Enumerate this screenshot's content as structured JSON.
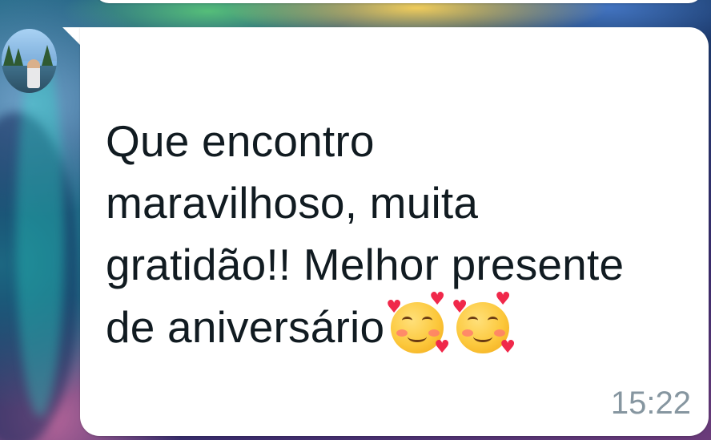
{
  "chat": {
    "message": {
      "lines": [
        "Que encontro",
        "maravilhoso, muita",
        "gratidão!! Melhor presente",
        "de aniversário"
      ],
      "emojis": [
        "smiling-face-with-hearts",
        "smiling-face-with-hearts"
      ],
      "time": "15:22"
    },
    "colors": {
      "bubble": "#ffffff",
      "text": "#111b21",
      "timestamp": "#8696a0"
    }
  }
}
